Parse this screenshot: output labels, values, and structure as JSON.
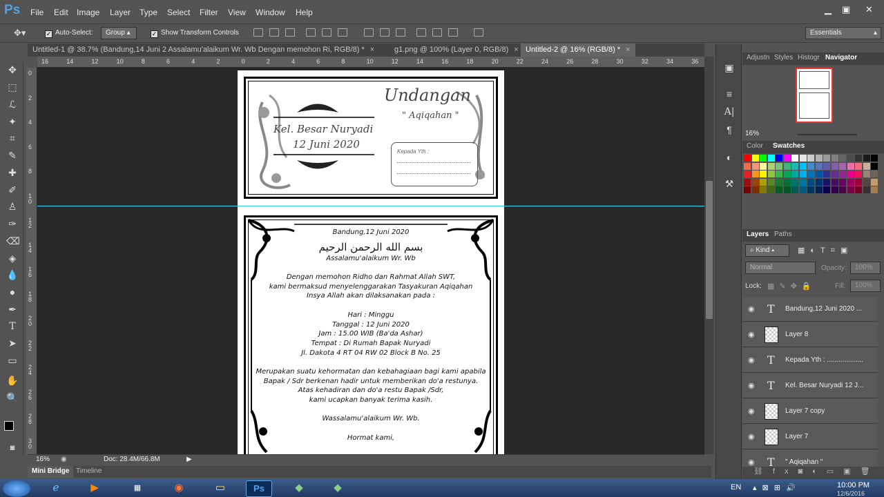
{
  "app": {
    "logo": "Ps"
  },
  "menu": [
    "File",
    "Edit",
    "Image",
    "Layer",
    "Type",
    "Select",
    "Filter",
    "View",
    "Window",
    "Help"
  ],
  "window_controls": {
    "minimize": "▁",
    "restore": "▣",
    "close": "✕"
  },
  "options": {
    "auto_select_label": "Auto-Select:",
    "auto_select_value": "Group",
    "transform_label": "Show Transform Controls",
    "workspace": "Essentials"
  },
  "tabs": [
    {
      "label": "Untitled-1 @ 38.7% (Bandung,14 Juni 2    Assalamu'alaikum Wr. Wb  Dengan memohon Ri, RGB/8) *",
      "close": "×"
    },
    {
      "label": "g1.png @ 100% (Layer 0, RGB/8)",
      "close": "×"
    },
    {
      "label": "Untitled-2 @ 16% (RGB/8) *",
      "close": "×"
    }
  ],
  "ruler": {
    "h": [
      "16",
      "14",
      "12",
      "10",
      "8",
      "6",
      "4",
      "2",
      "0",
      "2",
      "4",
      "6",
      "8",
      "10",
      "12",
      "14",
      "16",
      "18",
      "20",
      "22",
      "24",
      "26",
      "28",
      "30",
      "32",
      "34",
      "36"
    ],
    "v": [
      "0",
      "2",
      "4",
      "6",
      "8",
      "1 0",
      "1 2",
      "1 4",
      "1 6",
      "1 8",
      "2 0",
      "2 2",
      "2 4",
      "2 6",
      "2 8",
      "3 0"
    ]
  },
  "card_top": {
    "title": "Undangan",
    "subtitle": "\" Aqiqahan \"",
    "family": "Kel. Besar Nuryadi",
    "date": "12 Juni 2020",
    "kepada": "Kepada Yth :"
  },
  "card_bottom": {
    "lines": [
      "Bandung,12 Juni 2020",
      "بسم الله الرحمن الرحيم",
      "Assalamu'alaikum Wr. Wb",
      "",
      "Dengan memohon Ridho dan Rahmat Allah SWT,",
      "kami bermaksud menyelenggarakan Tasyakuran Aqiqahan",
      "Insya Allah akan dilaksanakan pada :",
      "",
      "Hari  :  Minggu",
      "Tanggal  :  12 Juni 2020",
      "Jam :  15.00 WIB (Ba'da Ashar)",
      "Tempat  :  Di Rumah Bapak Nuryadi",
      "Jl. Dakota 4 RT 04 RW 02 Block B No. 25",
      "",
      "Merupakan suatu kehormatan dan kebahagiaan bagi kami apabila",
      "Bapak / Sdr  berkenan hadir untuk memberikan do'a restunya.",
      "Atas kehadiran dan do'a restu Bapak /Sdr,",
      "kami ucapkan banyak terima kasih.",
      "",
      "Wassalamu'alaikum Wr. Wb.",
      "",
      "Hormat kami,"
    ]
  },
  "status": {
    "zoom": "16%",
    "doc": "Doc: 28.4M/66.8M"
  },
  "bottom_tabs": [
    "Mini Bridge",
    "Timeline"
  ],
  "panels": {
    "top_tabs": [
      "Adjustn",
      "Styles",
      "Histogr",
      "Navigator"
    ],
    "nav_zoom": "16%",
    "color_tabs": [
      "Color",
      "Swatches"
    ],
    "layers_tabs": [
      "Layers",
      "Paths"
    ],
    "kind": "Kind",
    "blend": "Normal",
    "opacity_label": "Opacity:",
    "opacity_value": "100%",
    "lock_label": "Lock:",
    "fill_label": "Fill:",
    "fill_value": "100%",
    "layers": [
      {
        "name": "Bandung,12 Juni 2020 ...",
        "type": "text"
      },
      {
        "name": "Layer 8",
        "type": "pixel"
      },
      {
        "name": "Kepada Yth : ...................",
        "type": "text"
      },
      {
        "name": "Kel. Besar Nuryadi 12 J...",
        "type": "text"
      },
      {
        "name": "Layer 7 copy",
        "type": "pixel"
      },
      {
        "name": "Layer 7",
        "type": "pixel"
      },
      {
        "name": "\" Aqiqahan \"",
        "type": "text"
      }
    ]
  },
  "taskbar": {
    "lang": "EN",
    "time": "10:00 PM",
    "date": "12/6/2016"
  },
  "swatch_rows": [
    [
      "#ff0000",
      "#ffff00",
      "#00ff00",
      "#00ffff",
      "#0000ff",
      "#ff00ff",
      "#ffffff",
      "#e6e6e6",
      "#cccccc",
      "#b3b3b3",
      "#999999",
      "#808080",
      "#666666",
      "#4d4d4d",
      "#333333",
      "#1a1a1a",
      "#000000"
    ],
    [
      "#f26c4f",
      "#f69679",
      "#fff799",
      "#acd372",
      "#7cc576",
      "#3bb878",
      "#1abbb4",
      "#00bff3",
      "#438ccb",
      "#5574b9",
      "#605ca8",
      "#855fa8",
      "#a763a9",
      "#ef6ea8",
      "#f16d7e",
      "#c7b299",
      "#000000"
    ],
    [
      "#ed1c24",
      "#f7941d",
      "#fff200",
      "#8dc63f",
      "#39b54a",
      "#00a651",
      "#00a99d",
      "#00aeef",
      "#0072bc",
      "#0054a6",
      "#2e3192",
      "#662d91",
      "#92278f",
      "#ec008c",
      "#ed145b",
      "#998675",
      "#736357"
    ],
    [
      "#9e0b0f",
      "#a0410d",
      "#aba000",
      "#598527",
      "#197b30",
      "#007236",
      "#00746b",
      "#0076a3",
      "#004b80",
      "#003471",
      "#1b1464",
      "#440e62",
      "#630460",
      "#9e005d",
      "#9e0039",
      "#534741",
      "#c69c6d"
    ],
    [
      "#790000",
      "#7b2e00",
      "#827b00",
      "#406618",
      "#005e20",
      "#005826",
      "#005952",
      "#005b7f",
      "#003663",
      "#002157",
      "#0d004c",
      "#32004b",
      "#4b0049",
      "#7b0046",
      "#7a0026",
      "#362f2d",
      "#a67c52"
    ]
  ]
}
